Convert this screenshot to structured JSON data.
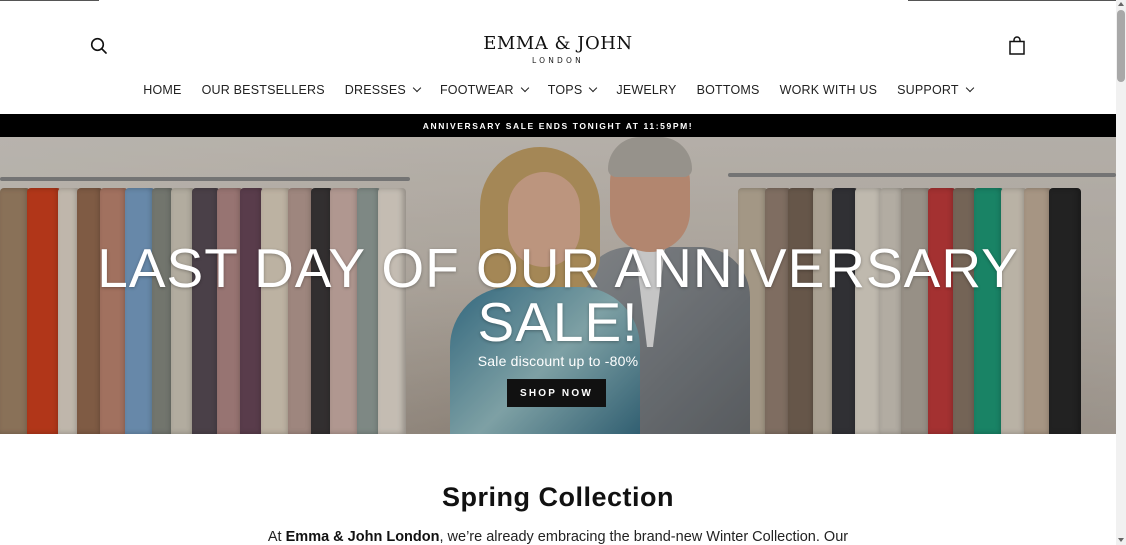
{
  "header": {
    "logo": {
      "main": "EMMA & JOHN",
      "sub": "LONDON"
    },
    "search_icon": "search-icon",
    "cart_icon": "shopping-bag-icon"
  },
  "nav": {
    "items": [
      {
        "label": "HOME",
        "dropdown": false
      },
      {
        "label": "OUR BESTSELLERS",
        "dropdown": false
      },
      {
        "label": "DRESSES",
        "dropdown": true
      },
      {
        "label": "FOOTWEAR",
        "dropdown": true
      },
      {
        "label": "TOPS",
        "dropdown": true
      },
      {
        "label": "JEWELRY",
        "dropdown": false
      },
      {
        "label": "BOTTOMS",
        "dropdown": false
      },
      {
        "label": "WORK WITH US",
        "dropdown": false
      },
      {
        "label": "SUPPORT",
        "dropdown": true
      }
    ]
  },
  "announcement": {
    "text": "ANNIVERSARY SALE ENDS TONIGHT AT 11:59PM!"
  },
  "hero": {
    "title_line1": "LAST DAY OF OUR ANNIVERSARY",
    "title_line2": "SALE!",
    "subtitle": "Sale discount up to -80%",
    "cta_label": "SHOP NOW"
  },
  "collection": {
    "title": "Spring Collection",
    "text_prefix": "At ",
    "text_brand": "Emma & John London",
    "text_suffix": ", we’re already embracing the brand-new Winter Collection. Our"
  },
  "colors": {
    "announcement_bg": "#000000",
    "button_bg": "#111111",
    "text": "#111111"
  }
}
